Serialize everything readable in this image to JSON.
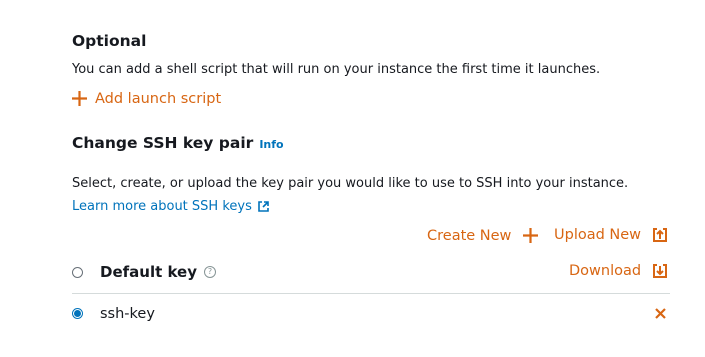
{
  "optional": {
    "title": "Optional",
    "description": "You can add a shell script that will run on your instance the first time it launches.",
    "add_script_label": "Add launch script"
  },
  "ssh": {
    "title": "Change SSH key pair",
    "info_label": "Info",
    "description": "Select, create, or upload the key pair you would like to use to SSH into your instance.",
    "learn_more_label": "Learn more about SSH keys",
    "create_new_label": "Create New",
    "upload_new_label": "Upload New",
    "download_label": "Download",
    "keys": [
      {
        "label": "Default key",
        "selected": false
      },
      {
        "label": "ssh-key",
        "selected": true
      }
    ]
  },
  "colors": {
    "accent": "#d86613",
    "link": "#0073bb",
    "text": "#16191f",
    "divider": "#d5dbdb"
  },
  "icons": [
    "plus-icon",
    "external-link-icon",
    "upload-icon",
    "download-icon",
    "help-icon",
    "close-icon"
  ]
}
